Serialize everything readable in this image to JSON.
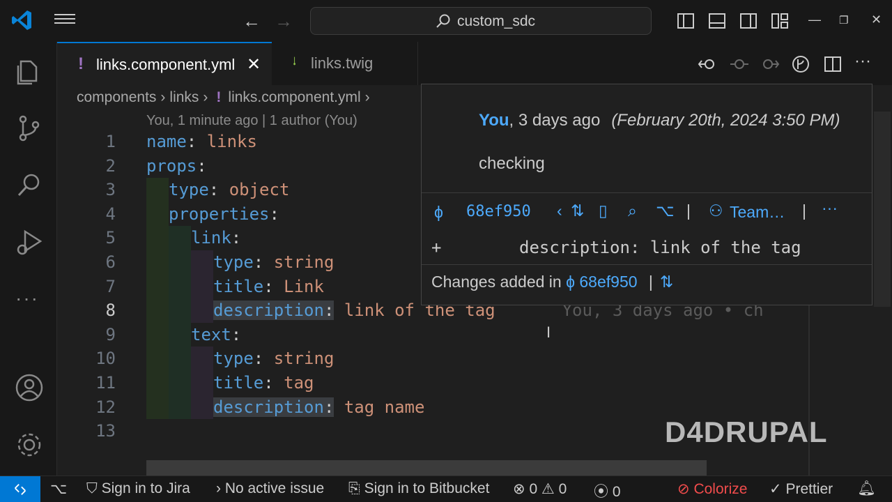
{
  "titlebar": {
    "search_text": "custom_sdc"
  },
  "tabs": [
    {
      "label": "links.component.yml",
      "icon": "yaml-exclamation-icon",
      "active": true
    },
    {
      "label": "links.twig",
      "icon": "twig-leaf-icon",
      "active": false
    }
  ],
  "breadcrumb": {
    "parts": [
      "components",
      "links",
      "links.component.yml"
    ]
  },
  "codelens": "You, 1 minute ago | 1 author (You)",
  "code": {
    "line_numbers": [
      "1",
      "2",
      "3",
      "4",
      "5",
      "6",
      "7",
      "8",
      "9",
      "10",
      "11",
      "12",
      "13"
    ],
    "current_line": "8",
    "l1_key": "name",
    "l1_val": "links",
    "l2_key": "props",
    "l3_key": "type",
    "l3_val": "object",
    "l4_key": "properties",
    "l5_key": "link",
    "l6_key": "type",
    "l6_val": "string",
    "l7_key": "title",
    "l7_val": "Link",
    "l8_key": "description",
    "l8_val": "link of the tag",
    "l8_blame": "You, 3 days ago • ch",
    "l9_key": "text",
    "l10_key": "type",
    "l10_val": "string",
    "l11_key": "title",
    "l11_val": "tag",
    "l12_key": "description",
    "l12_val": "tag name"
  },
  "hover": {
    "author": "You",
    "relative_time": ", 3 days ago",
    "date": "(February 20th, 2024 3:50 PM)",
    "message": "checking",
    "sha": "68ef950",
    "team_label": "Team…",
    "diff_sign": "+",
    "diff_text": "description: link of the tag",
    "changes_label": "Changes added in",
    "changes_sha": "68ef950",
    "separator": "|"
  },
  "watermark": "D4DRUPAL",
  "statusbar": {
    "jira": "Sign in to Jira",
    "issue": "No active issue",
    "bitbucket": "Sign in to Bitbucket",
    "errors": "0",
    "warnings": "0",
    "ports": "0",
    "colorize": "Colorize",
    "prettier": "Prettier"
  },
  "colors": {
    "accent": "#0078d4",
    "link": "#4daafc",
    "key": "#569cd6",
    "value": "#ce9178",
    "colorize_red": "#f14c4c"
  }
}
